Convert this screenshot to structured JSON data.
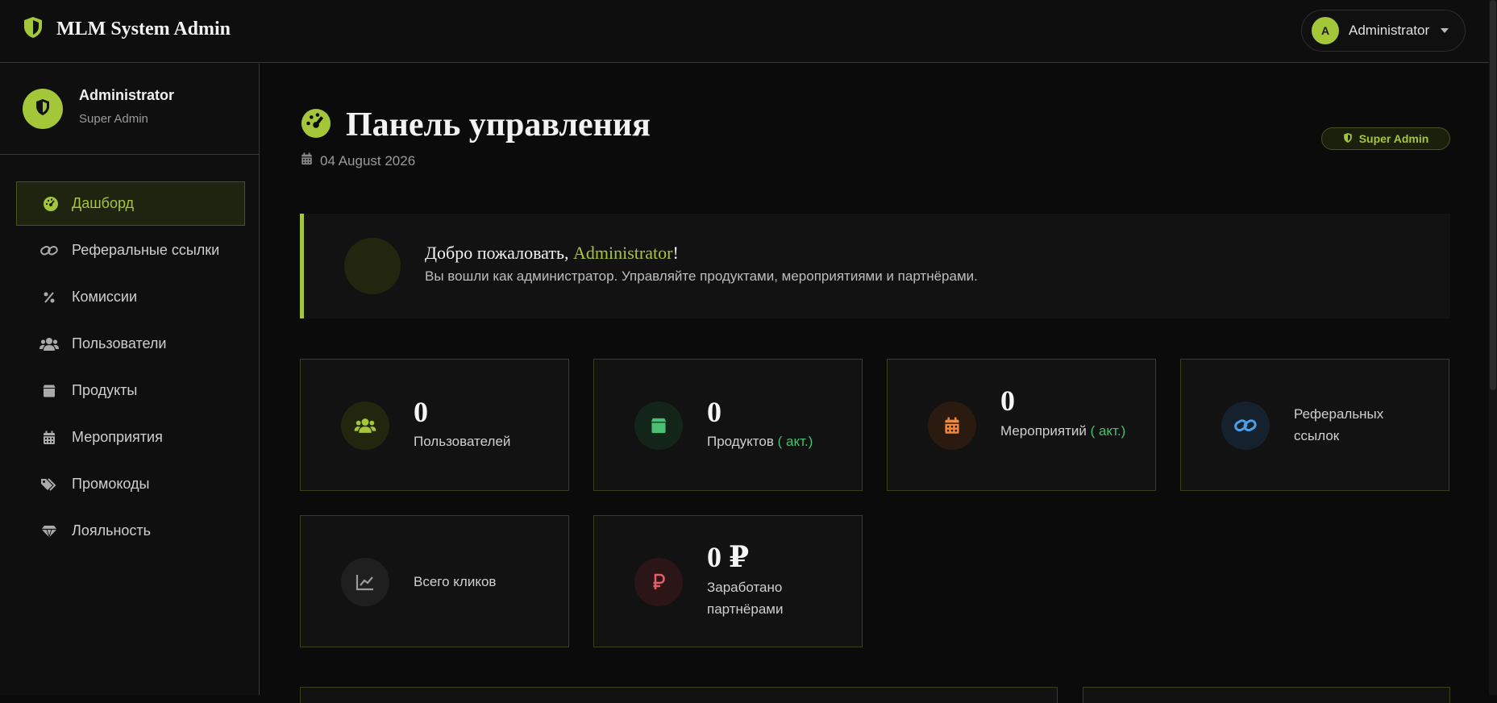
{
  "app": {
    "title": "MLM System Admin"
  },
  "user_menu": {
    "avatar_letter": "A",
    "name": "Administrator"
  },
  "profile": {
    "name": "Administrator",
    "role": "Super Admin"
  },
  "sidebar": {
    "items": [
      {
        "label": "Дашборд",
        "icon": "dashboard-icon",
        "active": true
      },
      {
        "label": "Реферальные ссылки",
        "icon": "link-icon"
      },
      {
        "label": "Комиссии",
        "icon": "percent-icon"
      },
      {
        "label": "Пользователи",
        "icon": "users-icon"
      },
      {
        "label": "Продукты",
        "icon": "box-icon"
      },
      {
        "label": "Мероприятия",
        "icon": "calendar-icon"
      },
      {
        "label": "Промокоды",
        "icon": "tags-icon"
      },
      {
        "label": "Лояльность",
        "icon": "gem-icon"
      }
    ]
  },
  "header": {
    "title": "Панель управления",
    "date": "04 August 2026",
    "badge": "Super Admin"
  },
  "welcome": {
    "greeting": "Добро пожаловать, ",
    "name": "Administrator",
    "exclaim": "!",
    "subtitle": "Вы вошли как администратор. Управляйте продуктами, мероприятиями и партнёрами."
  },
  "stats": {
    "users": {
      "value": "0",
      "label": "Пользователей"
    },
    "products": {
      "value": "0",
      "label": "Продуктов",
      "extra": "( акт.)"
    },
    "events": {
      "value": "0",
      "label": "Мероприятий",
      "extra": "( акт.)"
    },
    "links": {
      "label": "Реферальных ссылок"
    },
    "clicks": {
      "label": "Всего кликов"
    },
    "earned": {
      "value": "0 ₽",
      "label": "Заработано партнёрами"
    }
  },
  "colors": {
    "accent": "#a4c639",
    "background": "#0b0b0b",
    "green": "#4bbf73",
    "orange": "#f0883e",
    "blue": "#4a9fe8",
    "red": "#e35d6a"
  }
}
